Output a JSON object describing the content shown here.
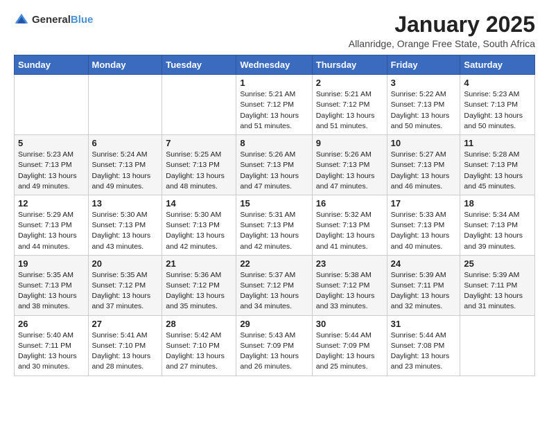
{
  "header": {
    "logo_general": "General",
    "logo_blue": "Blue",
    "month_title": "January 2025",
    "location": "Allanridge, Orange Free State, South Africa"
  },
  "days_of_week": [
    "Sunday",
    "Monday",
    "Tuesday",
    "Wednesday",
    "Thursday",
    "Friday",
    "Saturday"
  ],
  "weeks": [
    [
      {
        "day": "",
        "info": ""
      },
      {
        "day": "",
        "info": ""
      },
      {
        "day": "",
        "info": ""
      },
      {
        "day": "1",
        "info": "Sunrise: 5:21 AM\nSunset: 7:12 PM\nDaylight: 13 hours\nand 51 minutes."
      },
      {
        "day": "2",
        "info": "Sunrise: 5:21 AM\nSunset: 7:12 PM\nDaylight: 13 hours\nand 51 minutes."
      },
      {
        "day": "3",
        "info": "Sunrise: 5:22 AM\nSunset: 7:13 PM\nDaylight: 13 hours\nand 50 minutes."
      },
      {
        "day": "4",
        "info": "Sunrise: 5:23 AM\nSunset: 7:13 PM\nDaylight: 13 hours\nand 50 minutes."
      }
    ],
    [
      {
        "day": "5",
        "info": "Sunrise: 5:23 AM\nSunset: 7:13 PM\nDaylight: 13 hours\nand 49 minutes."
      },
      {
        "day": "6",
        "info": "Sunrise: 5:24 AM\nSunset: 7:13 PM\nDaylight: 13 hours\nand 49 minutes."
      },
      {
        "day": "7",
        "info": "Sunrise: 5:25 AM\nSunset: 7:13 PM\nDaylight: 13 hours\nand 48 minutes."
      },
      {
        "day": "8",
        "info": "Sunrise: 5:26 AM\nSunset: 7:13 PM\nDaylight: 13 hours\nand 47 minutes."
      },
      {
        "day": "9",
        "info": "Sunrise: 5:26 AM\nSunset: 7:13 PM\nDaylight: 13 hours\nand 47 minutes."
      },
      {
        "day": "10",
        "info": "Sunrise: 5:27 AM\nSunset: 7:13 PM\nDaylight: 13 hours\nand 46 minutes."
      },
      {
        "day": "11",
        "info": "Sunrise: 5:28 AM\nSunset: 7:13 PM\nDaylight: 13 hours\nand 45 minutes."
      }
    ],
    [
      {
        "day": "12",
        "info": "Sunrise: 5:29 AM\nSunset: 7:13 PM\nDaylight: 13 hours\nand 44 minutes."
      },
      {
        "day": "13",
        "info": "Sunrise: 5:30 AM\nSunset: 7:13 PM\nDaylight: 13 hours\nand 43 minutes."
      },
      {
        "day": "14",
        "info": "Sunrise: 5:30 AM\nSunset: 7:13 PM\nDaylight: 13 hours\nand 42 minutes."
      },
      {
        "day": "15",
        "info": "Sunrise: 5:31 AM\nSunset: 7:13 PM\nDaylight: 13 hours\nand 42 minutes."
      },
      {
        "day": "16",
        "info": "Sunrise: 5:32 AM\nSunset: 7:13 PM\nDaylight: 13 hours\nand 41 minutes."
      },
      {
        "day": "17",
        "info": "Sunrise: 5:33 AM\nSunset: 7:13 PM\nDaylight: 13 hours\nand 40 minutes."
      },
      {
        "day": "18",
        "info": "Sunrise: 5:34 AM\nSunset: 7:13 PM\nDaylight: 13 hours\nand 39 minutes."
      }
    ],
    [
      {
        "day": "19",
        "info": "Sunrise: 5:35 AM\nSunset: 7:13 PM\nDaylight: 13 hours\nand 38 minutes."
      },
      {
        "day": "20",
        "info": "Sunrise: 5:35 AM\nSunset: 7:12 PM\nDaylight: 13 hours\nand 37 minutes."
      },
      {
        "day": "21",
        "info": "Sunrise: 5:36 AM\nSunset: 7:12 PM\nDaylight: 13 hours\nand 35 minutes."
      },
      {
        "day": "22",
        "info": "Sunrise: 5:37 AM\nSunset: 7:12 PM\nDaylight: 13 hours\nand 34 minutes."
      },
      {
        "day": "23",
        "info": "Sunrise: 5:38 AM\nSunset: 7:12 PM\nDaylight: 13 hours\nand 33 minutes."
      },
      {
        "day": "24",
        "info": "Sunrise: 5:39 AM\nSunset: 7:11 PM\nDaylight: 13 hours\nand 32 minutes."
      },
      {
        "day": "25",
        "info": "Sunrise: 5:39 AM\nSunset: 7:11 PM\nDaylight: 13 hours\nand 31 minutes."
      }
    ],
    [
      {
        "day": "26",
        "info": "Sunrise: 5:40 AM\nSunset: 7:11 PM\nDaylight: 13 hours\nand 30 minutes."
      },
      {
        "day": "27",
        "info": "Sunrise: 5:41 AM\nSunset: 7:10 PM\nDaylight: 13 hours\nand 28 minutes."
      },
      {
        "day": "28",
        "info": "Sunrise: 5:42 AM\nSunset: 7:10 PM\nDaylight: 13 hours\nand 27 minutes."
      },
      {
        "day": "29",
        "info": "Sunrise: 5:43 AM\nSunset: 7:09 PM\nDaylight: 13 hours\nand 26 minutes."
      },
      {
        "day": "30",
        "info": "Sunrise: 5:44 AM\nSunset: 7:09 PM\nDaylight: 13 hours\nand 25 minutes."
      },
      {
        "day": "31",
        "info": "Sunrise: 5:44 AM\nSunset: 7:08 PM\nDaylight: 13 hours\nand 23 minutes."
      },
      {
        "day": "",
        "info": ""
      }
    ]
  ]
}
